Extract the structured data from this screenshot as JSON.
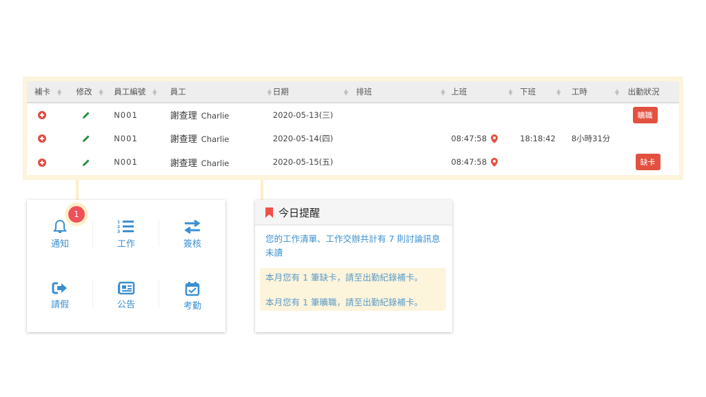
{
  "table": {
    "headers": [
      "補卡",
      "修改",
      "員工編號",
      "員工",
      "日期",
      "排班",
      "上班",
      "下班",
      "工時",
      "出勤狀況"
    ],
    "rows": [
      {
        "emp_id": "N001",
        "name_zh": "謝查理",
        "name_en": "Charlie",
        "date": "2020-05-13(三)",
        "shift": "",
        "clock_in": "",
        "clock_out": "",
        "hours": "",
        "status": "曠職"
      },
      {
        "emp_id": "N001",
        "name_zh": "謝查理",
        "name_en": "Charlie",
        "date": "2020-05-14(四)",
        "shift": "",
        "clock_in": "08:47:58",
        "clock_out": "18:18:42",
        "hours": "8小時31分",
        "status": ""
      },
      {
        "emp_id": "N001",
        "name_zh": "謝查理",
        "name_en": "Charlie",
        "date": "2020-05-15(五)",
        "shift": "",
        "clock_in": "08:47:58",
        "clock_out": "",
        "hours": "",
        "status": "缺卡"
      }
    ]
  },
  "quick_menu": {
    "items": [
      {
        "label": "通知",
        "icon": "bell-icon",
        "badge": "1"
      },
      {
        "label": "工作",
        "icon": "numbered-list-icon"
      },
      {
        "label": "簽核",
        "icon": "exchange-arrows-icon"
      },
      {
        "label": "請假",
        "icon": "sign-out-icon"
      },
      {
        "label": "公告",
        "icon": "newspaper-icon"
      },
      {
        "label": "考勤",
        "icon": "calendar-check-icon"
      }
    ]
  },
  "reminder": {
    "title": "今日提醒",
    "message": "您的工作清單、工作交辦共計有 7 則討論訊息未讀",
    "highlights": [
      "本月您有 1 筆缺卡，請至出勤紀錄補卡。",
      "本月您有 1 筆曠職，請至出勤紀錄補卡。"
    ]
  },
  "colors": {
    "accent_blue": "#3a8fd1",
    "danger_red": "#e2513f",
    "edit_green": "#1e8a3c",
    "highlight": "#fdf4dc"
  }
}
